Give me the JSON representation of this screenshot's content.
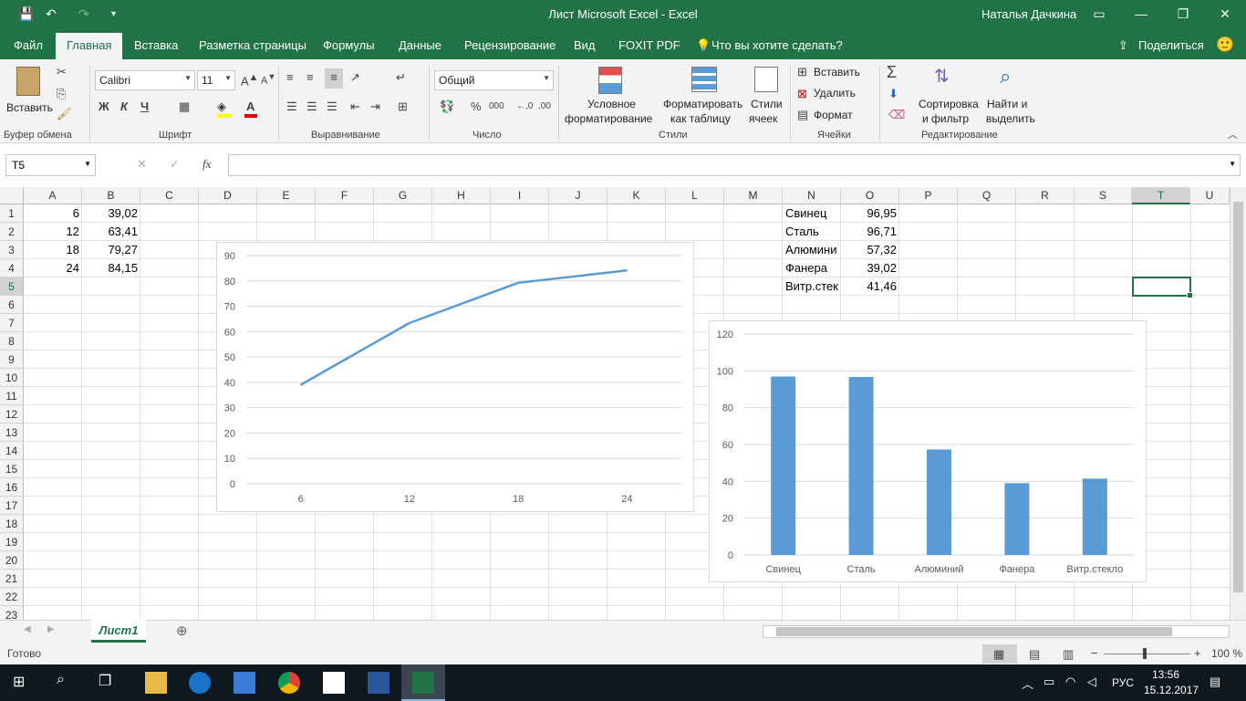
{
  "window": {
    "title": "Лист Microsoft Excel  -  Excel",
    "user": "Наталья Дачкина",
    "accent": "#217346"
  },
  "tabs": [
    "Файл",
    "Главная",
    "Вставка",
    "Разметка страницы",
    "Формулы",
    "Данные",
    "Рецензирование",
    "Вид",
    "FOXIT PDF",
    "Что вы хотите сделать?"
  ],
  "share_label": "Поделиться",
  "ribbon": {
    "clipboard": {
      "paste": "Вставить",
      "group": "Буфер обмена"
    },
    "font": {
      "name": "Calibri",
      "size": "11",
      "bold": "Ж",
      "italic": "К",
      "underline": "Ч",
      "group": "Шрифт"
    },
    "alignment": {
      "group": "Выравнивание"
    },
    "number": {
      "format": "Общий",
      "group": "Число"
    },
    "styles": {
      "conditional1": "Условное",
      "conditional2": "форматирование",
      "table1": "Форматировать",
      "table2": "как таблицу",
      "cell1": "Стили",
      "cell2": "ячеек",
      "group": "Стили"
    },
    "cells": {
      "insert": "Вставить",
      "delete": "Удалить",
      "format": "Формат",
      "group": "Ячейки"
    },
    "editing": {
      "sort1": "Сортировка",
      "sort2": "и фильтр",
      "find1": "Найти и",
      "find2": "выделить",
      "group": "Редактирование"
    }
  },
  "formula_bar": {
    "name_box": "T5",
    "formula": ""
  },
  "columns": [
    "A",
    "B",
    "C",
    "D",
    "E",
    "F",
    "G",
    "H",
    "I",
    "J",
    "K",
    "L",
    "M",
    "N",
    "O",
    "P",
    "Q",
    "R",
    "S",
    "T",
    "U"
  ],
  "rows": [
    "1",
    "2",
    "3",
    "4",
    "5",
    "6",
    "7",
    "8",
    "9",
    "10",
    "11",
    "12",
    "13",
    "14",
    "15",
    "16",
    "17",
    "18",
    "19",
    "20",
    "21",
    "22",
    "23"
  ],
  "cells": {
    "A": [
      "6",
      "12",
      "18",
      "24"
    ],
    "B": [
      "39,02",
      "63,41",
      "79,27",
      "84,15"
    ],
    "N": [
      "Свинец",
      "Сталь",
      "Алюмини",
      "Фанера",
      "Витр.стек"
    ],
    "O": [
      "96,95",
      "96,71",
      "57,32",
      "39,02",
      "41,46"
    ]
  },
  "chart_data": [
    {
      "type": "line",
      "categories": [
        "6",
        "12",
        "18",
        "24"
      ],
      "series": [
        {
          "values": [
            39.02,
            63.41,
            79.27,
            84.15
          ]
        }
      ],
      "ylim": [
        0,
        90
      ],
      "yticks": [
        "0",
        "10",
        "20",
        "30",
        "40",
        "50",
        "60",
        "70",
        "80",
        "90"
      ],
      "grid": true,
      "color": "#5b9bd5"
    },
    {
      "type": "bar",
      "categories": [
        "Свинец",
        "Сталь",
        "Алюминий",
        "Фанера",
        "Витр.стекло"
      ],
      "series": [
        {
          "values": [
            96.95,
            96.71,
            57.32,
            39.02,
            41.46
          ]
        }
      ],
      "ylim": [
        0,
        120
      ],
      "yticks": [
        "0",
        "20",
        "40",
        "60",
        "80",
        "100",
        "120"
      ],
      "grid": true,
      "color": "#5b9bd5"
    }
  ],
  "sheet": {
    "name": "Лист1"
  },
  "status": {
    "ready": "Готово",
    "zoom": "100 %"
  },
  "taskbar": {
    "lang": "РУС",
    "time": "13:56",
    "date": "15.12.2017"
  }
}
